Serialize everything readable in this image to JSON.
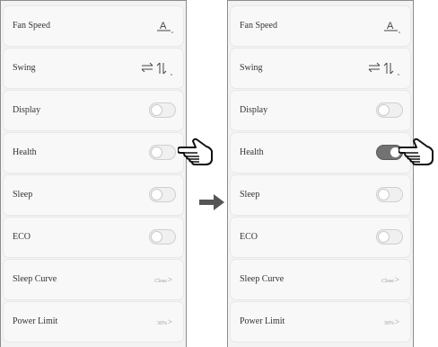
{
  "left_panel": {
    "rows": [
      {
        "label": "Fan Speed",
        "control": "fan-speed-icon"
      },
      {
        "label": "Swing",
        "control": "swing-icons"
      },
      {
        "label": "Display",
        "control": "toggle",
        "on": false
      },
      {
        "label": "Health",
        "control": "toggle",
        "on": false
      },
      {
        "label": "Sleep",
        "control": "toggle",
        "on": false
      },
      {
        "label": "ECO",
        "control": "toggle",
        "on": false
      },
      {
        "label": "Sleep Curve",
        "control": "value",
        "value": "Close",
        "chevron": ">"
      },
      {
        "label": "Power Limit",
        "control": "value",
        "value": "30%",
        "chevron": ">"
      }
    ]
  },
  "right_panel": {
    "rows": [
      {
        "label": "Fan Speed",
        "control": "fan-speed-icon"
      },
      {
        "label": "Swing",
        "control": "swing-icons"
      },
      {
        "label": "Display",
        "control": "toggle",
        "on": false
      },
      {
        "label": "Health",
        "control": "toggle",
        "on": true
      },
      {
        "label": "Sleep",
        "control": "toggle",
        "on": false
      },
      {
        "label": "ECO",
        "control": "toggle",
        "on": false
      },
      {
        "label": "Sleep Curve",
        "control": "value",
        "value": "Close",
        "chevron": ">"
      },
      {
        "label": "Power Limit",
        "control": "value",
        "value": "30%",
        "chevron": ">"
      }
    ]
  },
  "fan_speed_icon_letter": "A",
  "icons": {
    "pointer": "pointing-hand-icon",
    "transition": "right-arrow-icon",
    "fan_speed": "fan-speed-icon",
    "swing_horizontal": "swing-horizontal-icon",
    "swing_vertical": "swing-vertical-icon"
  },
  "colors": {
    "toggle_on": "#727272",
    "toggle_off": "#f0f0f0",
    "row_bg": "#f8f8f8",
    "panel_bg": "#f3f3f3"
  }
}
